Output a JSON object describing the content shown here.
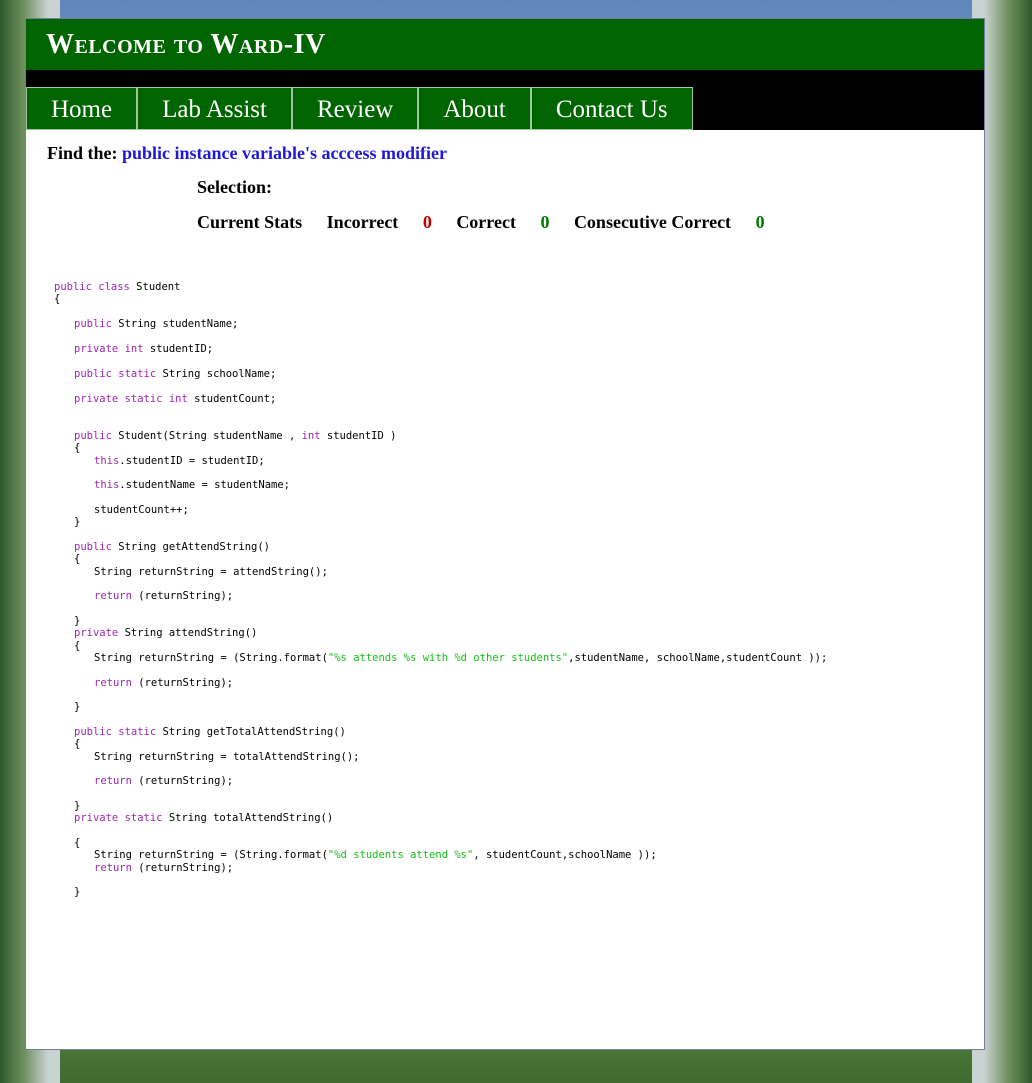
{
  "banner": {
    "title": "Welcome to Ward-IV"
  },
  "nav": {
    "items": [
      "Home",
      "Lab Assist",
      "Review",
      "About",
      "Contact Us"
    ]
  },
  "prompt": {
    "label": "Find the:",
    "target": "public instance variable's acccess modifier"
  },
  "selection": {
    "label": "Selection:"
  },
  "stats": {
    "title": "Current Stats",
    "incorrect_label": "Incorrect",
    "incorrect_value": "0",
    "correct_label": "Correct",
    "correct_value": "0",
    "consecutive_label": "Consecutive Correct",
    "consecutive_value": "0"
  },
  "code_lines": [
    {
      "indent": 0,
      "tokens": [
        [
          "kw",
          "public class"
        ],
        [
          "t",
          " Student"
        ]
      ]
    },
    {
      "indent": 0,
      "tokens": [
        [
          "t",
          "{"
        ]
      ]
    },
    {
      "indent": 1,
      "tokens": [
        [
          "kw",
          "public"
        ],
        [
          "t",
          " String studentName;"
        ]
      ]
    },
    {
      "indent": 1,
      "tokens": [
        [
          "kw",
          "private int"
        ],
        [
          "t",
          " studentID;"
        ]
      ]
    },
    {
      "indent": 1,
      "tokens": [
        [
          "kw",
          "public static"
        ],
        [
          "t",
          " String schoolName;"
        ]
      ]
    },
    {
      "indent": 1,
      "tokens": [
        [
          "kw",
          "private static int"
        ],
        [
          "t",
          " studentCount;"
        ]
      ]
    },
    {
      "indent": 1,
      "tokens": [
        [
          "kw",
          "public"
        ],
        [
          "t",
          " Student(String studentName , "
        ],
        [
          "kw",
          "int"
        ],
        [
          "t",
          " studentID )"
        ]
      ]
    },
    {
      "indent": 1,
      "tokens": [
        [
          "t",
          "{"
        ]
      ]
    },
    {
      "indent": 2,
      "tokens": [
        [
          "kw",
          "this"
        ],
        [
          "t",
          ".studentID = studentID;"
        ]
      ]
    },
    {
      "indent": 2,
      "tokens": [
        [
          "kw",
          "this"
        ],
        [
          "t",
          ".studentName = studentName;"
        ]
      ]
    },
    {
      "indent": 2,
      "tokens": [
        [
          "t",
          "studentCount++;"
        ]
      ]
    },
    {
      "indent": 1,
      "tokens": [
        [
          "t",
          "}"
        ]
      ]
    },
    {
      "indent": 1,
      "tokens": [
        [
          "kw",
          "public"
        ],
        [
          "t",
          " String getAttendString()"
        ]
      ]
    },
    {
      "indent": 1,
      "tokens": [
        [
          "t",
          "{"
        ]
      ]
    },
    {
      "indent": 2,
      "tokens": [
        [
          "t",
          "String returnString = attendString();"
        ]
      ]
    },
    {
      "indent": 2,
      "tokens": [
        [
          "kw",
          "return"
        ],
        [
          "t",
          " (returnString);"
        ]
      ]
    },
    {
      "indent": 1,
      "tokens": [
        [
          "t",
          "}"
        ]
      ]
    },
    {
      "indent": 1,
      "tokens": [
        [
          "kw",
          "private"
        ],
        [
          "t",
          " String attendString()"
        ]
      ]
    },
    {
      "indent": 1,
      "tokens": [
        [
          "t",
          "{"
        ]
      ]
    },
    {
      "indent": 2,
      "tokens": [
        [
          "t",
          "String returnString = (String.format("
        ],
        [
          "str",
          "\"%s attends %s with %d other students\""
        ],
        [
          "t",
          ",studentName, schoolName,studentCount ));"
        ]
      ]
    },
    {
      "indent": 2,
      "tokens": [
        [
          "kw",
          "return"
        ],
        [
          "t",
          " (returnString);"
        ]
      ]
    },
    {
      "indent": 1,
      "tokens": [
        [
          "t",
          "}"
        ]
      ]
    },
    {
      "indent": 1,
      "tokens": [
        [
          "kw",
          "public static"
        ],
        [
          "t",
          " String getTotalAttendString()"
        ]
      ]
    },
    {
      "indent": 1,
      "tokens": [
        [
          "t",
          "{"
        ]
      ]
    },
    {
      "indent": 2,
      "tokens": [
        [
          "t",
          "String returnString = totalAttendString();"
        ]
      ]
    },
    {
      "indent": 2,
      "tokens": [
        [
          "kw",
          "return"
        ],
        [
          "t",
          " (returnString);"
        ]
      ]
    },
    {
      "indent": 1,
      "tokens": [
        [
          "t",
          "}"
        ]
      ]
    },
    {
      "indent": 1,
      "tokens": [
        [
          "kw",
          "private static"
        ],
        [
          "t",
          " String totalAttendString()"
        ]
      ]
    },
    {
      "indent": 1,
      "tokens": [
        [
          "t",
          "{"
        ]
      ]
    },
    {
      "indent": 2,
      "tokens": [
        [
          "t",
          "String returnString = (String.format("
        ],
        [
          "str",
          "\"%d students attend %s\""
        ],
        [
          "t",
          ", studentCount,schoolName ));"
        ]
      ]
    },
    {
      "indent": 2,
      "tokens": [
        [
          "kw",
          "return"
        ],
        [
          "t",
          " (returnString);"
        ]
      ]
    },
    {
      "indent": 1,
      "tokens": [
        [
          "t",
          "}"
        ]
      ]
    }
  ]
}
